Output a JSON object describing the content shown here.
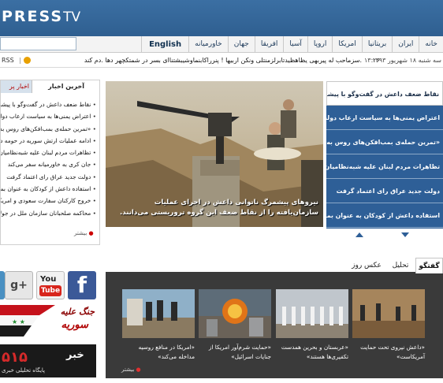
{
  "header": {
    "logo_main": "PRESS",
    "logo_tv": "TV"
  },
  "nav": {
    "search_placeholder": "",
    "items": [
      "خانه",
      "ایران",
      "بریتانیا",
      "امریکا",
      "اروپا",
      "آسیا",
      "افریقا",
      "جهان",
      "خاورمیانه",
      "English"
    ]
  },
  "ticker": {
    "rss": "RSS",
    "headline": "سزماحب له پیربهی یظاهظیدتابرلزمنتلی ونکن اربیها ! پنرراکابنماوشیبشتناای بسر در شمتکچهر دها .دم کند.",
    "time": "۱۳:۲۶",
    "date": "سه شنبه ۱۸ شهریور ۱۳۹۳"
  },
  "latest_news": {
    "tab_latest": "آخرین اخبار",
    "tab_other": "اخبار پر",
    "items": [
      "نقاط ضعف داعش در گفت‌وگو با پیشمرگ",
      "اعتراض یمنی‌ها به سیاست ارعاب دولت",
      "«تمرین حمله‌ی بمب‌افکن‌های روس به آمریکا»",
      "ادامه عملیات ارتش سوریه در حومه دمشق",
      "تظاهرات مردم لبنان علیه شبه‌نظامیان",
      "جان کری به خاورمیانه سفر می‌کند",
      "دولت جدید عراق رای اعتماد گرفت",
      "استفاده داعش از کودکان به عنوان بمب‌گذار",
      "خروج کارکنان سفارت سعودی و امریکا",
      "محاکمه صلحبانان سازمان ملل در جولان"
    ],
    "more": "بیشتر"
  },
  "slider": {
    "caption": "نیروهای پیشمرگ ناتوانی داعش در اجرای عملیات سازمان‌یافته را از نقاط ضعف این گروه تروریستی می‌دانند.",
    "items": [
      "نقاط ضعف داعش در گفت‌وگو با پیشمرگ",
      "اعتراض یمنی‌ها به سیاست ارعاب دولت",
      "«تمرین حمله‌ی بمب‌افکن‌های روس به آمریکا»",
      "تظاهرات مردم لبنان علیه شبه‌نظامیان",
      "دولت جدید عراق رای اعتماد گرفت",
      "استفاده داعش از کودکان به عنوان بمب‌گذار"
    ],
    "active_index": 0
  },
  "social": {
    "gplus": "g+",
    "youtube_you": "You",
    "youtube_tube": "Tube",
    "facebook": "f"
  },
  "banners": {
    "syria_line1": "جنگ علیه",
    "syria_line2": "سوریه",
    "channel_num": "۵۱۵",
    "channel_khabar": "خبر",
    "channel_sub": "پایگاه تحلیلی خبری"
  },
  "bottom_tabs": [
    "گفتگو",
    "تحلیل",
    "عکس روز"
  ],
  "gallery": {
    "items": [
      "«داعش نیروی تحت حمایت آمریکاست»",
      "«عربستان و بحرین همدست تکفیری‌ها هستند»",
      "«حمایت شرم‌آور امریکا از جنایات اسرائیل»",
      "«امریکا در منافع روسیه مداخله می‌کند»"
    ],
    "more": "بیشتر"
  }
}
